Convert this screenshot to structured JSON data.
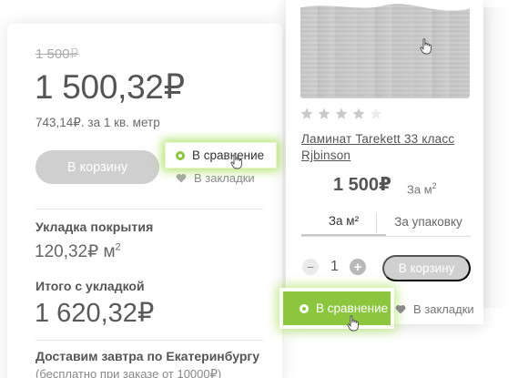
{
  "left_panel": {
    "old_price": "1 500₽",
    "price": "1 500,32₽",
    "per_meter": "743,14₽. за 1 кв. метр",
    "cart_button": "В корзину",
    "bookmarks": "В закладки",
    "laying_label": "Укладка покрытия",
    "laying_price": "120,32₽ м",
    "laying_price_sup": "2",
    "total_label": "Итого с укладкой",
    "total_price": "1 620,32₽",
    "delivery": "Доставим завтра по Екатеринбургу",
    "delivery_note": "(бесплатно при заказе от 10000₽)"
  },
  "compare_tooltip": {
    "label": "В сравнение"
  },
  "product_card": {
    "rating": 4,
    "rating_max": 5,
    "title": "Ламинат Tarekett 33 класс Rjbinson",
    "price": "1 500₽",
    "unit": "За м",
    "unit_sup": "2",
    "tabs": [
      {
        "label": "За м²",
        "active": true
      },
      {
        "label": "За упаковку",
        "active": false
      }
    ],
    "qty_minus": "−",
    "quantity": "1",
    "qty_plus": "+",
    "cart_button": "В корзину",
    "compare_button": "В сравнение",
    "bookmarks": "В закладки"
  },
  "colors": {
    "accent_green": "#8cc63f",
    "button_grey": "#cfcfcf",
    "text_dark": "#555555"
  },
  "icons": [
    "radio-dot-icon",
    "heart-icon",
    "star-icon",
    "hand-cursor-icon",
    "minus-icon",
    "plus-icon"
  ]
}
